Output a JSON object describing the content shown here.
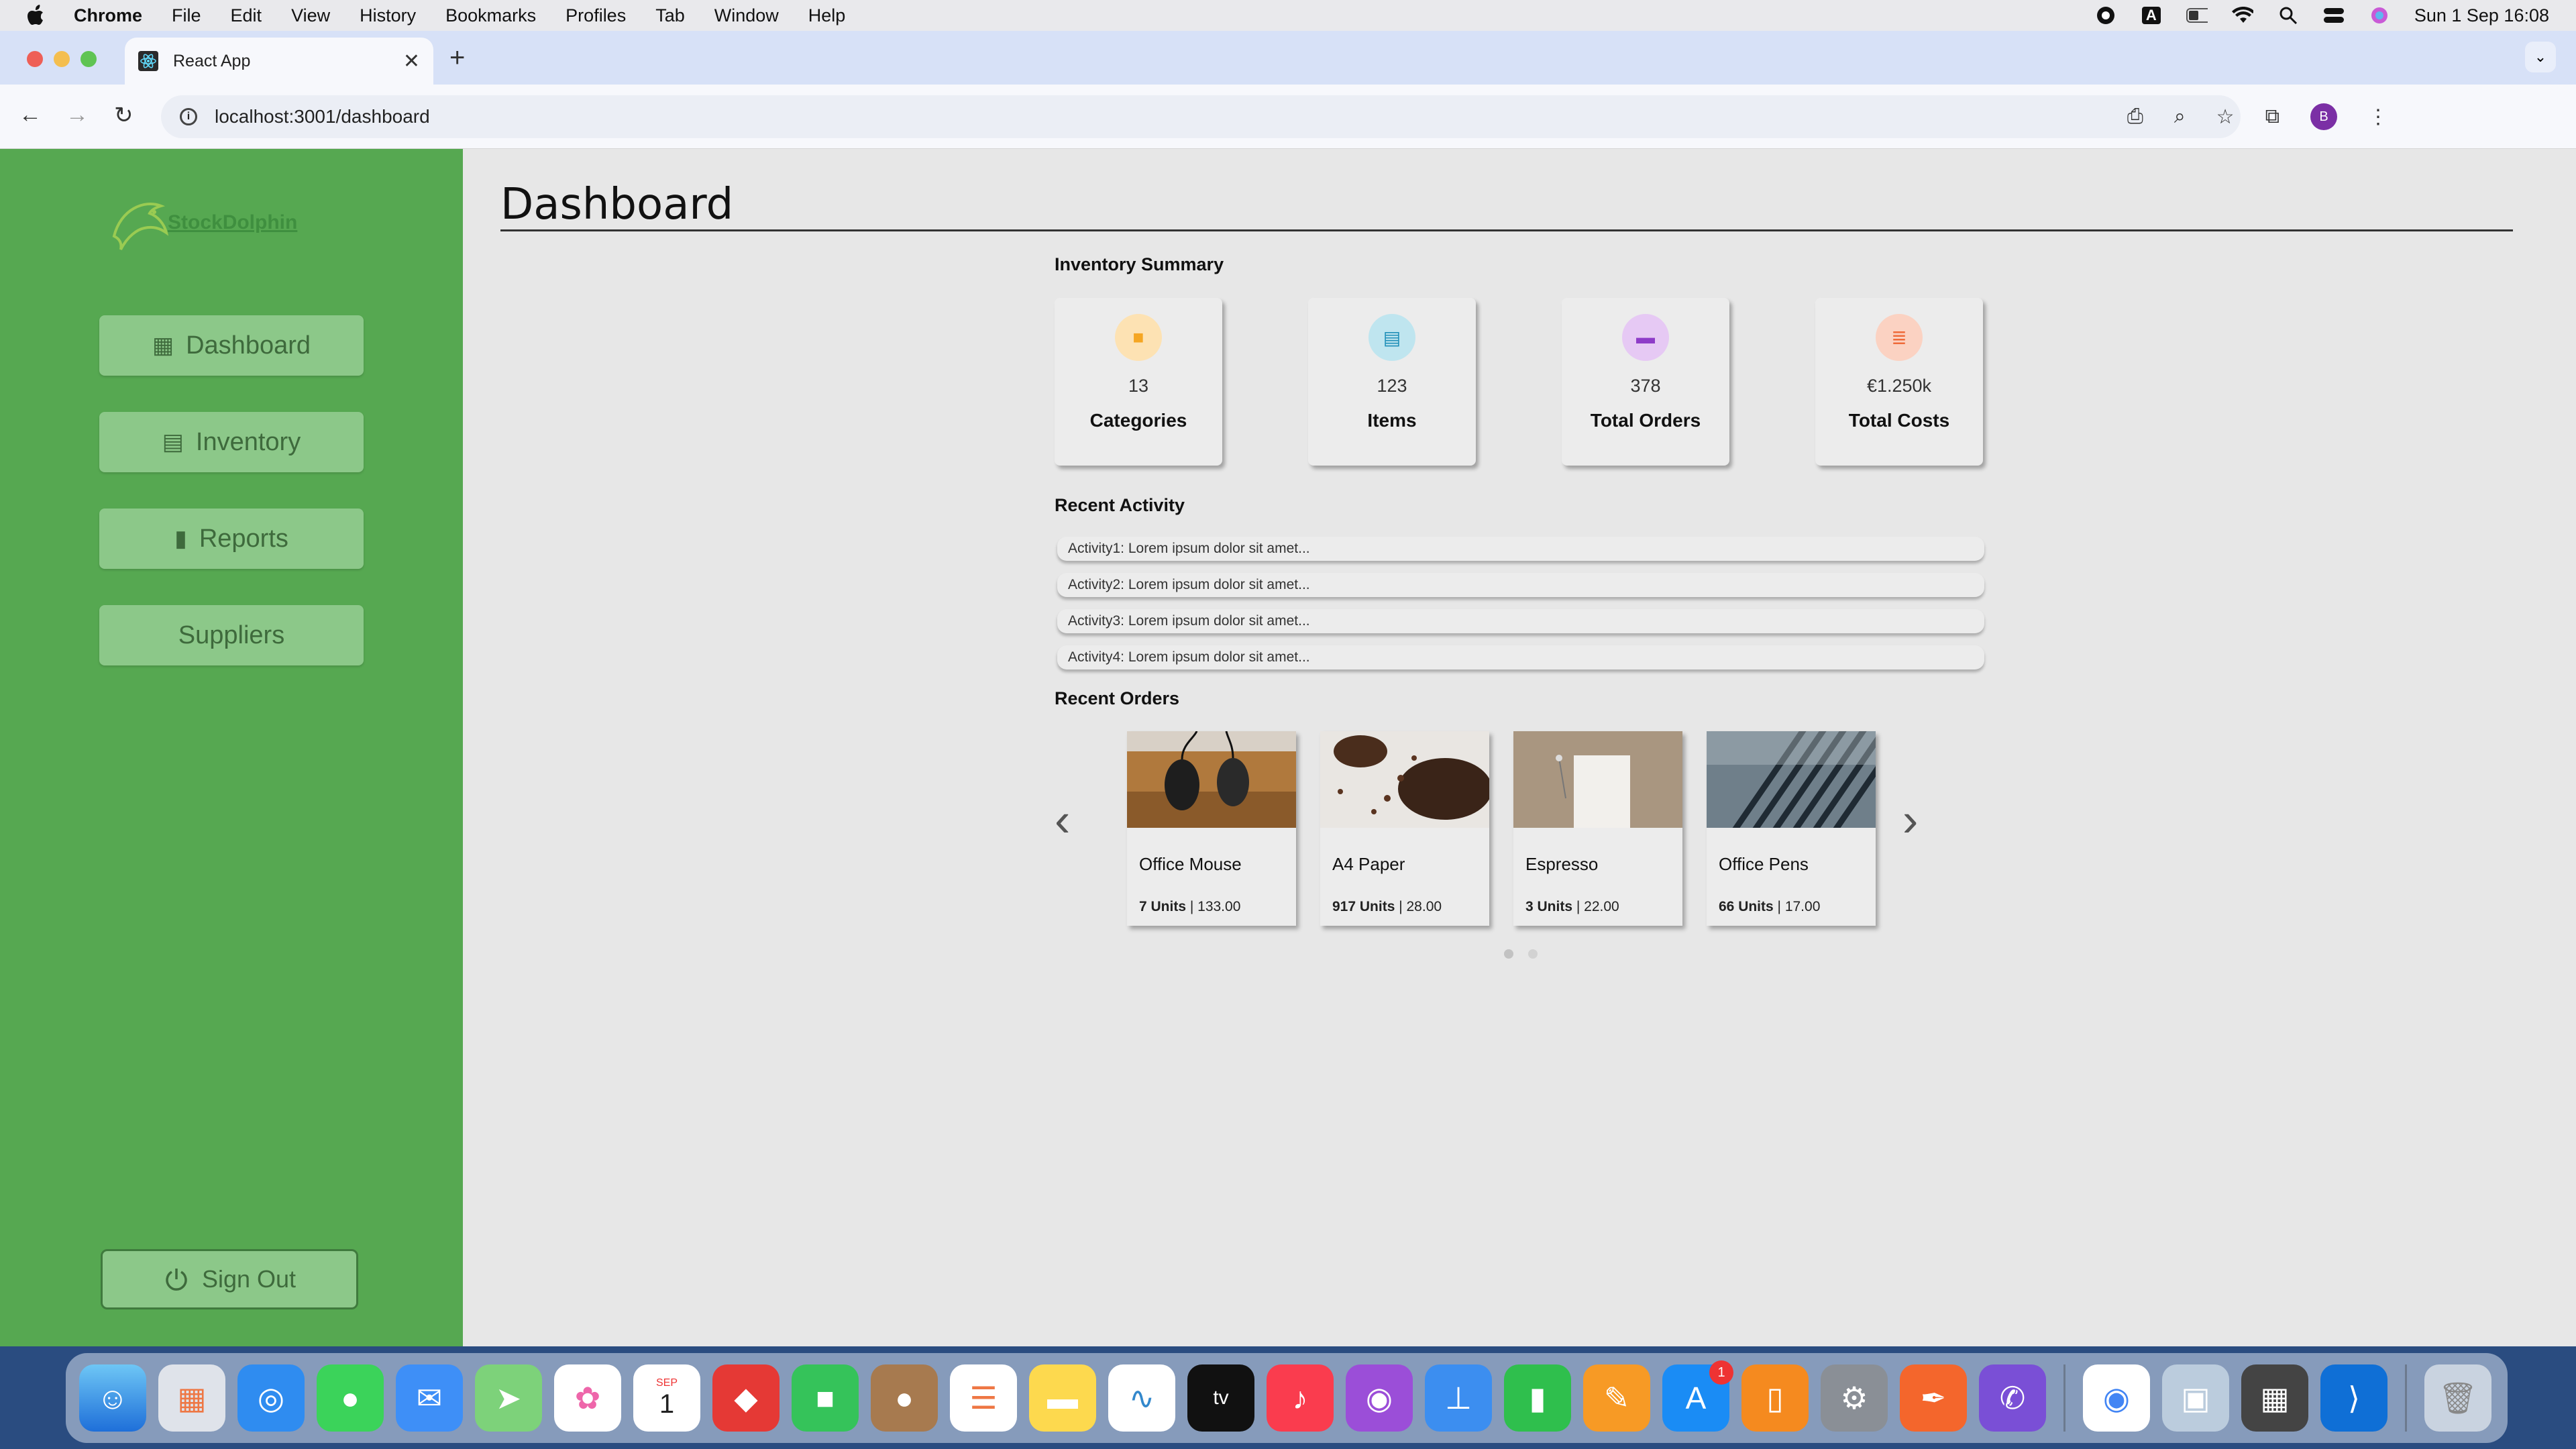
{
  "menubar": {
    "app": "Chrome",
    "items": [
      "File",
      "Edit",
      "View",
      "History",
      "Bookmarks",
      "Profiles",
      "Tab",
      "Window",
      "Help"
    ],
    "datetime": "Sun 1 Sep  16:08",
    "input_source": "A"
  },
  "browser": {
    "tab_title": "React App",
    "url": "localhost:3001/dashboard",
    "profile_initial": "B"
  },
  "sidebar": {
    "logo_text": "StockDolphin",
    "items": [
      {
        "label": "Dashboard",
        "icon": "grid-icon"
      },
      {
        "label": "Inventory",
        "icon": "box-icon"
      },
      {
        "label": "Reports",
        "icon": "bar-chart-icon"
      },
      {
        "label": "Suppliers",
        "icon": ""
      }
    ],
    "signout_label": "Sign Out"
  },
  "page": {
    "title": "Dashboard"
  },
  "summary": {
    "heading": "Inventory Summary",
    "cards": [
      {
        "value": "13",
        "label": "Categories",
        "icon": "folder-icon",
        "color": "#f5a623",
        "bg": "#fde2b3"
      },
      {
        "value": "123",
        "label": "Items",
        "icon": "document-icon",
        "color": "#1f8fb8",
        "bg": "#bfe5ef"
      },
      {
        "value": "378",
        "label": "Total Orders",
        "icon": "book-icon",
        "color": "#8e3cc8",
        "bg": "#e6c9f4"
      },
      {
        "value": "€1.250k",
        "label": "Total Costs",
        "icon": "coins-icon",
        "color": "#ef6b3a",
        "bg": "#fbd2c2"
      }
    ]
  },
  "activity": {
    "heading": "Recent Activity",
    "items": [
      "Activity1: Lorem ipsum dolor sit amet...",
      "Activity2: Lorem ipsum dolor sit amet...",
      "Activity3: Lorem ipsum dolor sit amet...",
      "Activity4: Lorem ipsum dolor sit amet..."
    ]
  },
  "orders": {
    "heading": "Recent Orders",
    "items": [
      {
        "name": "Office Mouse",
        "units": "7 Units",
        "price": "133.00"
      },
      {
        "name": "A4 Paper",
        "units": "917 Units",
        "price": "28.00"
      },
      {
        "name": "Espresso",
        "units": "3 Units",
        "price": "22.00"
      },
      {
        "name": "Office Pens",
        "units": "66 Units",
        "price": "17.00"
      }
    ],
    "pages": 2,
    "current_page": 1
  },
  "dock": {
    "apps": [
      "Finder",
      "Launchpad",
      "Safari",
      "Messages",
      "Mail",
      "Maps",
      "Photos",
      "Calendar",
      "AnyDesk",
      "FaceTime",
      "Contacts",
      "Reminders",
      "Notes",
      "Freeform",
      "Apple TV",
      "Music",
      "Podcasts",
      "Keynote",
      "Numbers",
      "Pages",
      "App Store",
      "Books",
      "System Settings",
      "Affinity",
      "Viber",
      "Chrome",
      "Preview",
      "Calculator",
      "VS Code",
      "Trash"
    ],
    "calendar_month": "SEP",
    "calendar_day": "1",
    "appstore_badge": "1"
  }
}
